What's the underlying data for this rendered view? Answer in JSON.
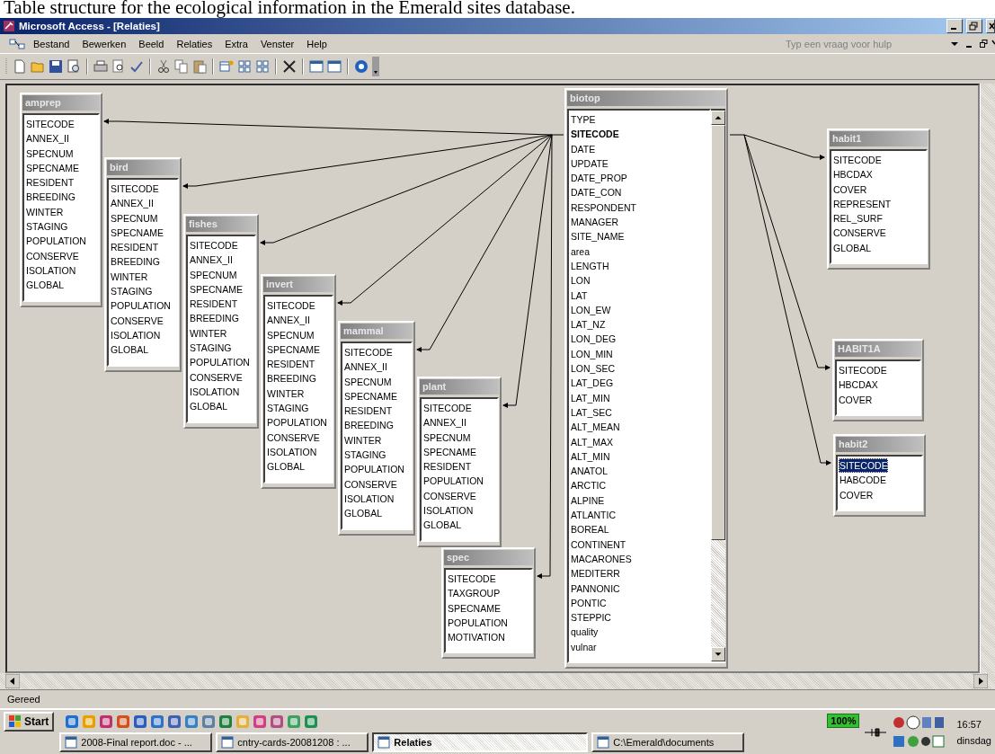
{
  "caption": "Table structure for the ecological information in the Emerald sites database.",
  "window": {
    "title": "Microsoft Access - [Relaties]"
  },
  "menu": [
    "Bestand",
    "Bewerken",
    "Beeld",
    "Relaties",
    "Extra",
    "Venster",
    "Help"
  ],
  "help_box": {
    "placeholder": "Typ een vraag voor hulp"
  },
  "tables": [
    {
      "name": "amprep",
      "fields": [
        {
          "name": "SITECODE",
          "selected": false
        },
        {
          "name": "ANNEX_II",
          "selected": false
        },
        {
          "name": "SPECNUM",
          "selected": false
        },
        {
          "name": "SPECNAME",
          "selected": false
        },
        {
          "name": "RESIDENT",
          "selected": false
        },
        {
          "name": "BREEDING",
          "selected": false
        },
        {
          "name": "WINTER",
          "selected": false
        },
        {
          "name": "STAGING",
          "selected": false
        },
        {
          "name": "POPULATION",
          "selected": false
        },
        {
          "name": "CONSERVE",
          "selected": false
        },
        {
          "name": "ISOLATION",
          "selected": false
        },
        {
          "name": "GLOBAL",
          "selected": false
        }
      ]
    },
    {
      "name": "bird",
      "fields": [
        {
          "name": "SITECODE",
          "selected": false
        },
        {
          "name": "ANNEX_II",
          "selected": false
        },
        {
          "name": "SPECNUM",
          "selected": false
        },
        {
          "name": "SPECNAME",
          "selected": false
        },
        {
          "name": "RESIDENT",
          "selected": false
        },
        {
          "name": "BREEDING",
          "selected": false
        },
        {
          "name": "WINTER",
          "selected": false
        },
        {
          "name": "STAGING",
          "selected": false
        },
        {
          "name": "POPULATION",
          "selected": false
        },
        {
          "name": "CONSERVE",
          "selected": false
        },
        {
          "name": "ISOLATION",
          "selected": false
        },
        {
          "name": "GLOBAL",
          "selected": false
        }
      ]
    },
    {
      "name": "fishes",
      "fields": [
        {
          "name": "SITECODE",
          "selected": false
        },
        {
          "name": "ANNEX_II",
          "selected": false
        },
        {
          "name": "SPECNUM",
          "selected": false
        },
        {
          "name": "SPECNAME",
          "selected": false
        },
        {
          "name": "RESIDENT",
          "selected": false
        },
        {
          "name": "BREEDING",
          "selected": false
        },
        {
          "name": "WINTER",
          "selected": false
        },
        {
          "name": "STAGING",
          "selected": false
        },
        {
          "name": "POPULATION",
          "selected": false
        },
        {
          "name": "CONSERVE",
          "selected": false
        },
        {
          "name": "ISOLATION",
          "selected": false
        },
        {
          "name": "GLOBAL",
          "selected": false
        }
      ]
    },
    {
      "name": "invert",
      "fields": [
        {
          "name": "SITECODE",
          "selected": false
        },
        {
          "name": "ANNEX_II",
          "selected": false
        },
        {
          "name": "SPECNUM",
          "selected": false
        },
        {
          "name": "SPECNAME",
          "selected": false
        },
        {
          "name": "RESIDENT",
          "selected": false
        },
        {
          "name": "BREEDING",
          "selected": false
        },
        {
          "name": "WINTER",
          "selected": false
        },
        {
          "name": "STAGING",
          "selected": false
        },
        {
          "name": "POPULATION",
          "selected": false
        },
        {
          "name": "CONSERVE",
          "selected": false
        },
        {
          "name": "ISOLATION",
          "selected": false
        },
        {
          "name": "GLOBAL",
          "selected": false
        }
      ]
    },
    {
      "name": "mammal",
      "fields": [
        {
          "name": "SITECODE",
          "selected": false
        },
        {
          "name": "ANNEX_II",
          "selected": false
        },
        {
          "name": "SPECNUM",
          "selected": false
        },
        {
          "name": "SPECNAME",
          "selected": false
        },
        {
          "name": "RESIDENT",
          "selected": false
        },
        {
          "name": "BREEDING",
          "selected": false
        },
        {
          "name": "WINTER",
          "selected": false
        },
        {
          "name": "STAGING",
          "selected": false
        },
        {
          "name": "POPULATION",
          "selected": false
        },
        {
          "name": "CONSERVE",
          "selected": false
        },
        {
          "name": "ISOLATION",
          "selected": false
        },
        {
          "name": "GLOBAL",
          "selected": false
        }
      ]
    },
    {
      "name": "plant",
      "fields": [
        {
          "name": "SITECODE",
          "selected": false
        },
        {
          "name": "ANNEX_II",
          "selected": false
        },
        {
          "name": "SPECNUM",
          "selected": false
        },
        {
          "name": "SPECNAME",
          "selected": false
        },
        {
          "name": "RESIDENT",
          "selected": false
        },
        {
          "name": "POPULATION",
          "selected": false
        },
        {
          "name": "CONSERVE",
          "selected": false
        },
        {
          "name": "ISOLATION",
          "selected": false
        },
        {
          "name": "GLOBAL",
          "selected": false
        }
      ]
    },
    {
      "name": "spec",
      "fields": [
        {
          "name": "SITECODE",
          "selected": false
        },
        {
          "name": "TAXGROUP",
          "selected": false
        },
        {
          "name": "SPECNAME",
          "selected": false
        },
        {
          "name": "POPULATION",
          "selected": false
        },
        {
          "name": "MOTIVATION",
          "selected": false
        }
      ]
    },
    {
      "name": "biotop",
      "fields": [
        {
          "name": "TYPE",
          "selected": false
        },
        {
          "name": "SITECODE",
          "selected": false,
          "key": true
        },
        {
          "name": "DATE",
          "selected": false
        },
        {
          "name": "UPDATE",
          "selected": false
        },
        {
          "name": "DATE_PROP",
          "selected": false
        },
        {
          "name": "DATE_CON",
          "selected": false
        },
        {
          "name": "RESPONDENT",
          "selected": false
        },
        {
          "name": "MANAGER",
          "selected": false
        },
        {
          "name": "SITE_NAME",
          "selected": false
        },
        {
          "name": "area",
          "selected": false
        },
        {
          "name": "LENGTH",
          "selected": false
        },
        {
          "name": "LON",
          "selected": false
        },
        {
          "name": "LAT",
          "selected": false
        },
        {
          "name": "LON_EW",
          "selected": false
        },
        {
          "name": "LAT_NZ",
          "selected": false
        },
        {
          "name": "LON_DEG",
          "selected": false
        },
        {
          "name": "LON_MIN",
          "selected": false
        },
        {
          "name": "LON_SEC",
          "selected": false
        },
        {
          "name": "LAT_DEG",
          "selected": false
        },
        {
          "name": "LAT_MIN",
          "selected": false
        },
        {
          "name": "LAT_SEC",
          "selected": false
        },
        {
          "name": "ALT_MEAN",
          "selected": false
        },
        {
          "name": "ALT_MAX",
          "selected": false
        },
        {
          "name": "ALT_MIN",
          "selected": false
        },
        {
          "name": "ANATOL",
          "selected": false
        },
        {
          "name": "ARCTIC",
          "selected": false
        },
        {
          "name": "ALPINE",
          "selected": false
        },
        {
          "name": "ATLANTIC",
          "selected": false
        },
        {
          "name": "BOREAL",
          "selected": false
        },
        {
          "name": "CONTINENT",
          "selected": false
        },
        {
          "name": "MACARONES",
          "selected": false
        },
        {
          "name": "MEDITERR",
          "selected": false
        },
        {
          "name": "PANNONIC",
          "selected": false
        },
        {
          "name": "PONTIC",
          "selected": false
        },
        {
          "name": "STEPPIC",
          "selected": false
        },
        {
          "name": "quality",
          "selected": false
        },
        {
          "name": "vulnar",
          "selected": false
        }
      ]
    },
    {
      "name": "habit1",
      "fields": [
        {
          "name": "SITECODE",
          "selected": false
        },
        {
          "name": "HBCDAX",
          "selected": false
        },
        {
          "name": "COVER",
          "selected": false
        },
        {
          "name": "REPRESENT",
          "selected": false
        },
        {
          "name": "REL_SURF",
          "selected": false
        },
        {
          "name": "CONSERVE",
          "selected": false
        },
        {
          "name": "GLOBAL",
          "selected": false
        }
      ]
    },
    {
      "name": "HABIT1A",
      "fields": [
        {
          "name": "SITECODE",
          "selected": false
        },
        {
          "name": "HBCDAX",
          "selected": false
        },
        {
          "name": "COVER",
          "selected": false
        }
      ]
    },
    {
      "name": "habit2",
      "fields": [
        {
          "name": "SITECODE",
          "selected": true
        },
        {
          "name": "HABCODE",
          "selected": false
        },
        {
          "name": "COVER",
          "selected": false
        }
      ]
    }
  ],
  "status_bar": "Gereed",
  "taskbar": {
    "start": "Start",
    "tasks": [
      {
        "label": "2008-Final report.doc - ...",
        "selected": false
      },
      {
        "label": "cntry-cards-20081208 : ...",
        "selected": false
      },
      {
        "label": "Relaties",
        "selected": true
      },
      {
        "label": "C:\\Emerald\\documents",
        "selected": false
      }
    ],
    "battery": "100%",
    "time": "16:57",
    "day": "dinsdag"
  }
}
